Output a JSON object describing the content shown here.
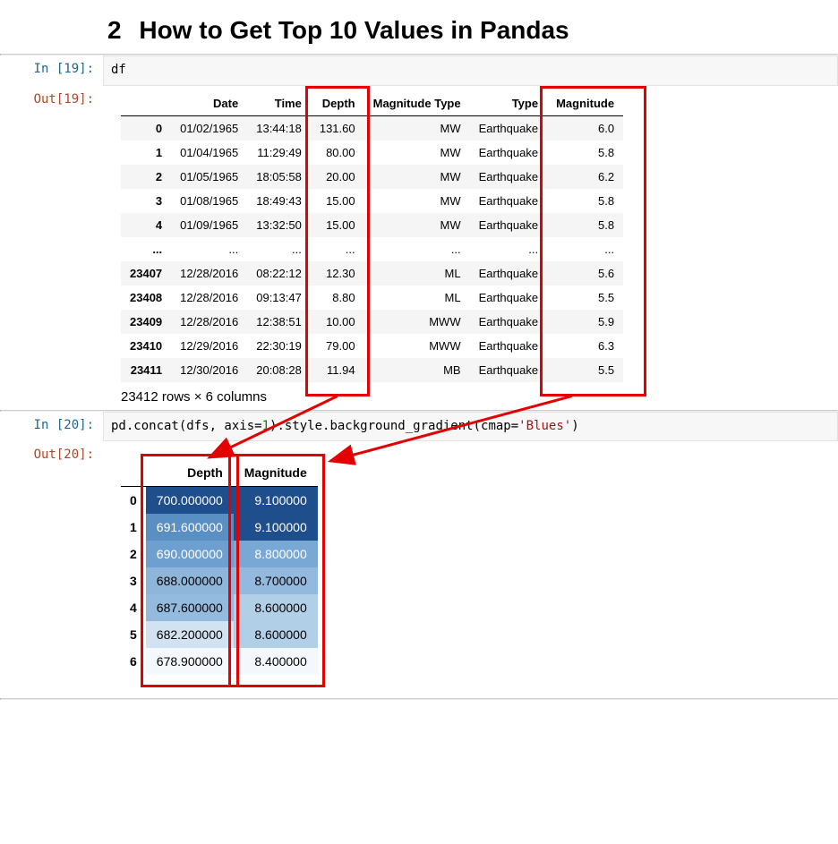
{
  "heading": {
    "num": "2",
    "text": "How to Get Top 10 Values in Pandas"
  },
  "cell1": {
    "in_label": "In [19]:",
    "out_label": "Out[19]:",
    "code": "df",
    "columns": [
      "Date",
      "Time",
      "Depth",
      "Magnitude Type",
      "Type",
      "Magnitude"
    ],
    "rows": [
      {
        "idx": "0",
        "c": [
          "01/02/1965",
          "13:44:18",
          "131.60",
          "MW",
          "Earthquake",
          "6.0"
        ]
      },
      {
        "idx": "1",
        "c": [
          "01/04/1965",
          "11:29:49",
          "80.00",
          "MW",
          "Earthquake",
          "5.8"
        ]
      },
      {
        "idx": "2",
        "c": [
          "01/05/1965",
          "18:05:58",
          "20.00",
          "MW",
          "Earthquake",
          "6.2"
        ]
      },
      {
        "idx": "3",
        "c": [
          "01/08/1965",
          "18:49:43",
          "15.00",
          "MW",
          "Earthquake",
          "5.8"
        ]
      },
      {
        "idx": "4",
        "c": [
          "01/09/1965",
          "13:32:50",
          "15.00",
          "MW",
          "Earthquake",
          "5.8"
        ]
      },
      {
        "idx": "...",
        "c": [
          "...",
          "...",
          "...",
          "...",
          "...",
          "..."
        ]
      },
      {
        "idx": "23407",
        "c": [
          "12/28/2016",
          "08:22:12",
          "12.30",
          "ML",
          "Earthquake",
          "5.6"
        ]
      },
      {
        "idx": "23408",
        "c": [
          "12/28/2016",
          "09:13:47",
          "8.80",
          "ML",
          "Earthquake",
          "5.5"
        ]
      },
      {
        "idx": "23409",
        "c": [
          "12/28/2016",
          "12:38:51",
          "10.00",
          "MWW",
          "Earthquake",
          "5.9"
        ]
      },
      {
        "idx": "23410",
        "c": [
          "12/29/2016",
          "22:30:19",
          "79.00",
          "MWW",
          "Earthquake",
          "6.3"
        ]
      },
      {
        "idx": "23411",
        "c": [
          "12/30/2016",
          "20:08:28",
          "11.94",
          "MB",
          "Earthquake",
          "5.5"
        ]
      }
    ],
    "summary": "23412 rows × 6 columns"
  },
  "cell2": {
    "in_label": "In [20]:",
    "out_label": "Out[20]:",
    "code_parts": {
      "p1": "pd.concat(dfs, axis=",
      "num": "1",
      "p2": ").style.background_gradient(cmap=",
      "str": "'Blues'",
      "p3": ")"
    },
    "columns": [
      "Depth",
      "Magnitude"
    ],
    "rows": [
      {
        "idx": "0",
        "depth": "700.000000",
        "mag": "9.100000",
        "dbg": "#1f4e8c",
        "dfg": "#fff",
        "mbg": "#1f4e8c",
        "mfg": "#fff"
      },
      {
        "idx": "1",
        "depth": "691.600000",
        "mag": "9.100000",
        "dbg": "#5a8fc4",
        "dfg": "#fff",
        "mbg": "#1f4e8c",
        "mfg": "#fff"
      },
      {
        "idx": "2",
        "depth": "690.000000",
        "mag": "8.800000",
        "dbg": "#6e9fcf",
        "dfg": "#fff",
        "mbg": "#7aa8d4",
        "mfg": "#fff"
      },
      {
        "idx": "3",
        "depth": "688.000000",
        "mag": "8.700000",
        "dbg": "#8db6da",
        "dfg": "#000",
        "mbg": "#93bade",
        "mfg": "#000"
      },
      {
        "idx": "4",
        "depth": "687.600000",
        "mag": "8.600000",
        "dbg": "#94bbde",
        "dfg": "#000",
        "mbg": "#b2cfe8",
        "mfg": "#000"
      },
      {
        "idx": "5",
        "depth": "682.200000",
        "mag": "8.600000",
        "dbg": "#d3e2f1",
        "dfg": "#000",
        "mbg": "#b2cfe8",
        "mfg": "#000"
      },
      {
        "idx": "6",
        "depth": "678.900000",
        "mag": "8.400000",
        "dbg": "#f4f8fc",
        "dfg": "#000",
        "mbg": "#f4f8fc",
        "mfg": "#000"
      }
    ]
  }
}
